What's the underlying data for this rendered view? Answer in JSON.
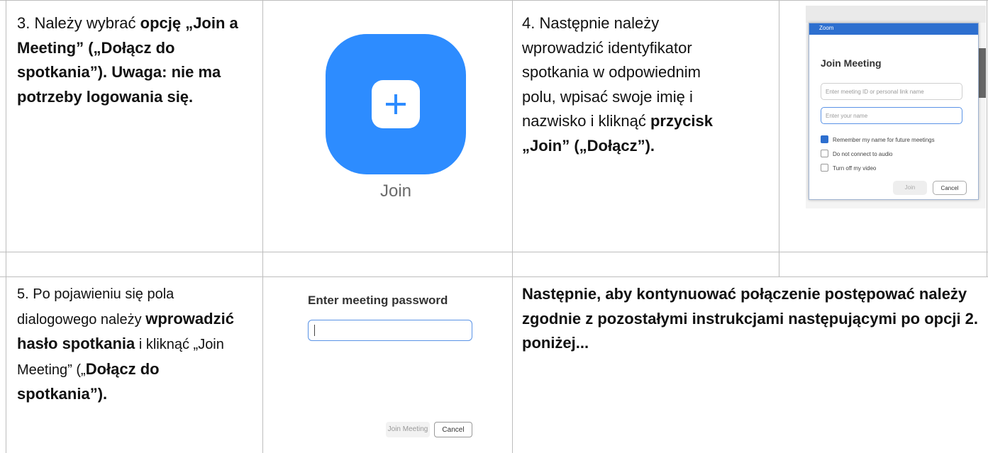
{
  "step3": {
    "prefix": "3. Należy wybrać ",
    "bold": "opcję „Join a Meeting” („Dołącz do spotkania”). Uwaga: nie ma potrzeby logowania się."
  },
  "join_icon": {
    "label": "Join",
    "icon": "plus-icon",
    "color": "#2d8cff"
  },
  "step4": {
    "text": "4. Następnie należy wprowadzić identyfikator spotkania w odpowiednim polu, wpisać swoje imię i nazwisko i kliknąć ",
    "bold": "przycisk „Join” („Dołącz”)."
  },
  "zoom_dialog": {
    "window_title": "Zoom",
    "title": "Join Meeting",
    "meeting_id_placeholder": "Enter meeting ID or personal link name",
    "name_placeholder": "Enter your name",
    "checkboxes": [
      {
        "label": "Remember my name for future meetings",
        "checked": true
      },
      {
        "label": "Do not connect to audio",
        "checked": false
      },
      {
        "label": "Turn off my video",
        "checked": false
      }
    ],
    "join_button": "Join",
    "cancel_button": "Cancel",
    "accent": "#2d6fcf"
  },
  "step5": {
    "prefix": "5. Po pojawieniu się pola dialogowego należy ",
    "bold1": "wprowadzić hasło spotkania",
    "middle": " i kliknąć „Join Meeting” („",
    "bold2": "Dołącz do spotkania”)."
  },
  "password_dialog": {
    "title": "Enter meeting password",
    "join_button": "Join Meeting",
    "cancel_button": "Cancel"
  },
  "continue_note": "Następnie, aby kontynuować połączenie postępować należy zgodnie z pozostałymi instrukcjami następującymi po opcji 2. poniżej..."
}
